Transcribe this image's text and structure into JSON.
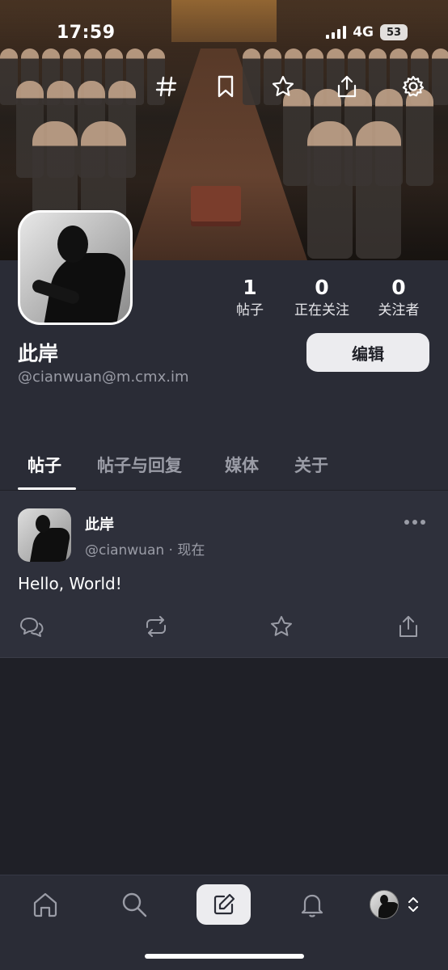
{
  "status_bar": {
    "time": "17:59",
    "network": "4G",
    "battery": "53"
  },
  "header": {
    "icons": [
      "hashtag-icon",
      "bookmark-icon",
      "star-icon",
      "share-icon",
      "gear-icon"
    ]
  },
  "profile": {
    "display_name": "此岸",
    "handle": "@cianwuan@m.cmx.im",
    "edit_label": "编辑",
    "stats": [
      {
        "num": "1",
        "label": "帖子"
      },
      {
        "num": "0",
        "label": "正在关注"
      },
      {
        "num": "0",
        "label": "关注者"
      }
    ]
  },
  "tabs": [
    {
      "label": "帖子",
      "active": true
    },
    {
      "label": "帖子与回复",
      "active": false
    },
    {
      "label": "媒体",
      "active": false
    },
    {
      "label": "关于",
      "active": false
    }
  ],
  "post": {
    "author": "此岸",
    "meta": "@cianwuan · 现在",
    "text": "Hello, World!",
    "actions": [
      "reply-icon",
      "boost-icon",
      "favorite-icon",
      "share-icon"
    ]
  },
  "bottom_nav": {
    "items": [
      "home-icon",
      "search-icon",
      "compose-icon",
      "bell-icon",
      "account-avatar"
    ]
  },
  "colors": {
    "background": "#1f2027",
    "surface": "#2a2c36",
    "post_surface": "#2e303b",
    "muted_text": "#9a9ca6",
    "button": "#ececef"
  }
}
